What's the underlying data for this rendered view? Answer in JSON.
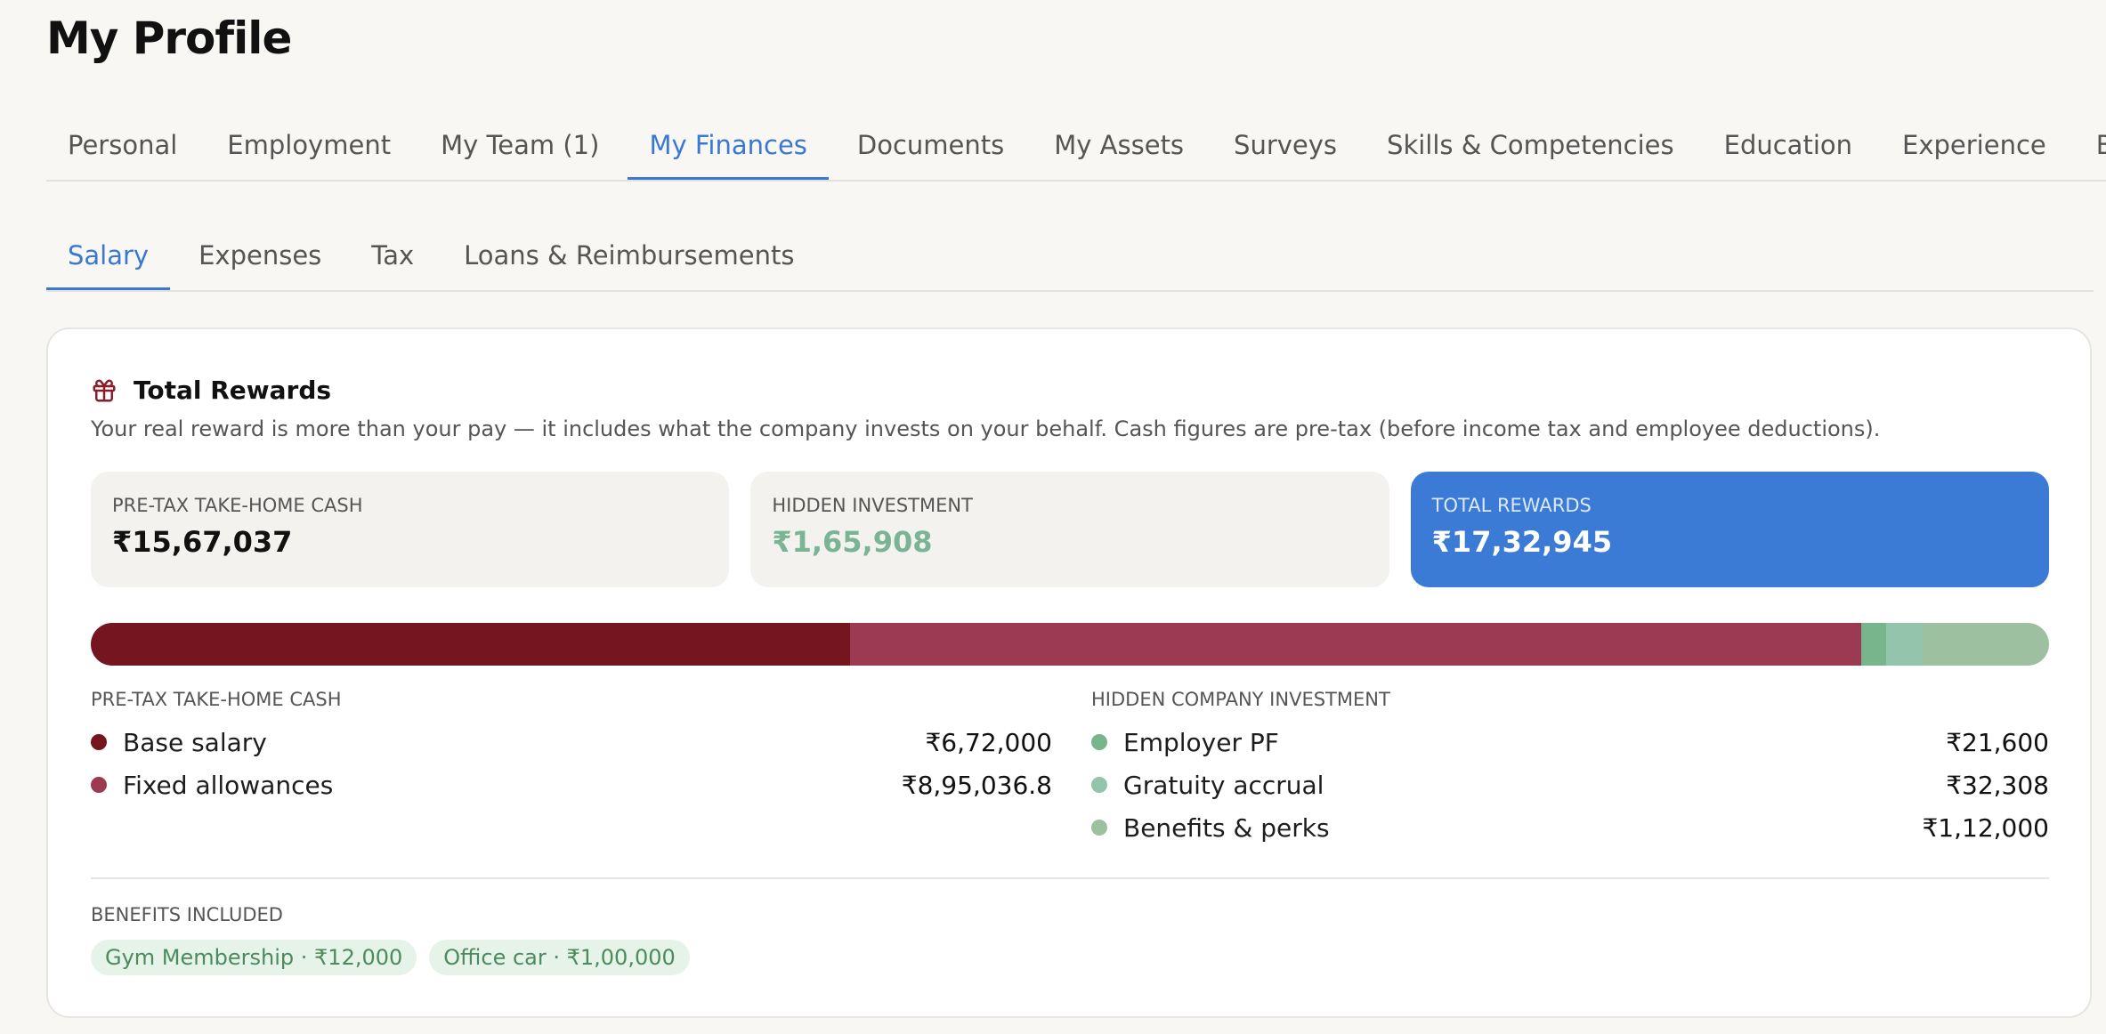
{
  "page": {
    "title": "My Profile"
  },
  "main_tabs": [
    {
      "label": "Personal"
    },
    {
      "label": "Employment"
    },
    {
      "label": "My Team (1)"
    },
    {
      "label": "My Finances"
    },
    {
      "label": "Documents"
    },
    {
      "label": "My Assets"
    },
    {
      "label": "Surveys"
    },
    {
      "label": "Skills & Competencies"
    },
    {
      "label": "Education"
    },
    {
      "label": "Experience"
    },
    {
      "label": "Bar"
    }
  ],
  "sub_tabs": [
    {
      "label": "Salary"
    },
    {
      "label": "Expenses"
    },
    {
      "label": "Tax"
    },
    {
      "label": "Loans & Reimbursements"
    }
  ],
  "card": {
    "title": "Total Rewards",
    "icon": "gift-icon",
    "description": "Your real reward is more than your pay — it includes what the company invests on your behalf. Cash figures are pre-tax (before income tax and employee deductions).",
    "stats": {
      "cash": {
        "label": "PRE-TAX TAKE-HOME CASH",
        "value": "₹15,67,037"
      },
      "hidden": {
        "label": "HIDDEN INVESTMENT",
        "value": "₹1,65,908"
      },
      "total": {
        "label": "TOTAL REWARDS",
        "value": "₹17,32,945"
      }
    },
    "bar_segments": [
      {
        "name": "Base salary",
        "amount": 672000,
        "color": "#741520"
      },
      {
        "name": "Fixed allowances",
        "amount": 895036.8,
        "color": "#9c3a52"
      },
      {
        "name": "Employer PF",
        "amount": 21600,
        "color": "#79b58c"
      },
      {
        "name": "Gratuity accrual",
        "amount": 32308,
        "color": "#92c5ab"
      },
      {
        "name": "Benefits & perks",
        "amount": 112000,
        "color": "#9cc0a0"
      }
    ],
    "cash_breakdown": {
      "heading": "PRE-TAX TAKE-HOME CASH",
      "items": [
        {
          "label": "Base salary",
          "value": "₹6,72,000",
          "color": "#741520"
        },
        {
          "label": "Fixed allowances",
          "value": "₹8,95,036.8",
          "color": "#9c3a52"
        }
      ]
    },
    "hidden_breakdown": {
      "heading": "HIDDEN COMPANY INVESTMENT",
      "items": [
        {
          "label": "Employer PF",
          "value": "₹21,600",
          "color": "#79b58c"
        },
        {
          "label": "Gratuity accrual",
          "value": "₹32,308",
          "color": "#92c5ab"
        },
        {
          "label": "Benefits & perks",
          "value": "₹1,12,000",
          "color": "#9cc0a0"
        }
      ]
    },
    "benefits": {
      "heading": "BENEFITS INCLUDED",
      "chips": [
        {
          "label": "Gym Membership · ₹12,000"
        },
        {
          "label": "Office car · ₹1,00,000"
        }
      ]
    }
  },
  "colors": {
    "accent": "#3b7bd6",
    "hidden_green": "#79b594"
  }
}
